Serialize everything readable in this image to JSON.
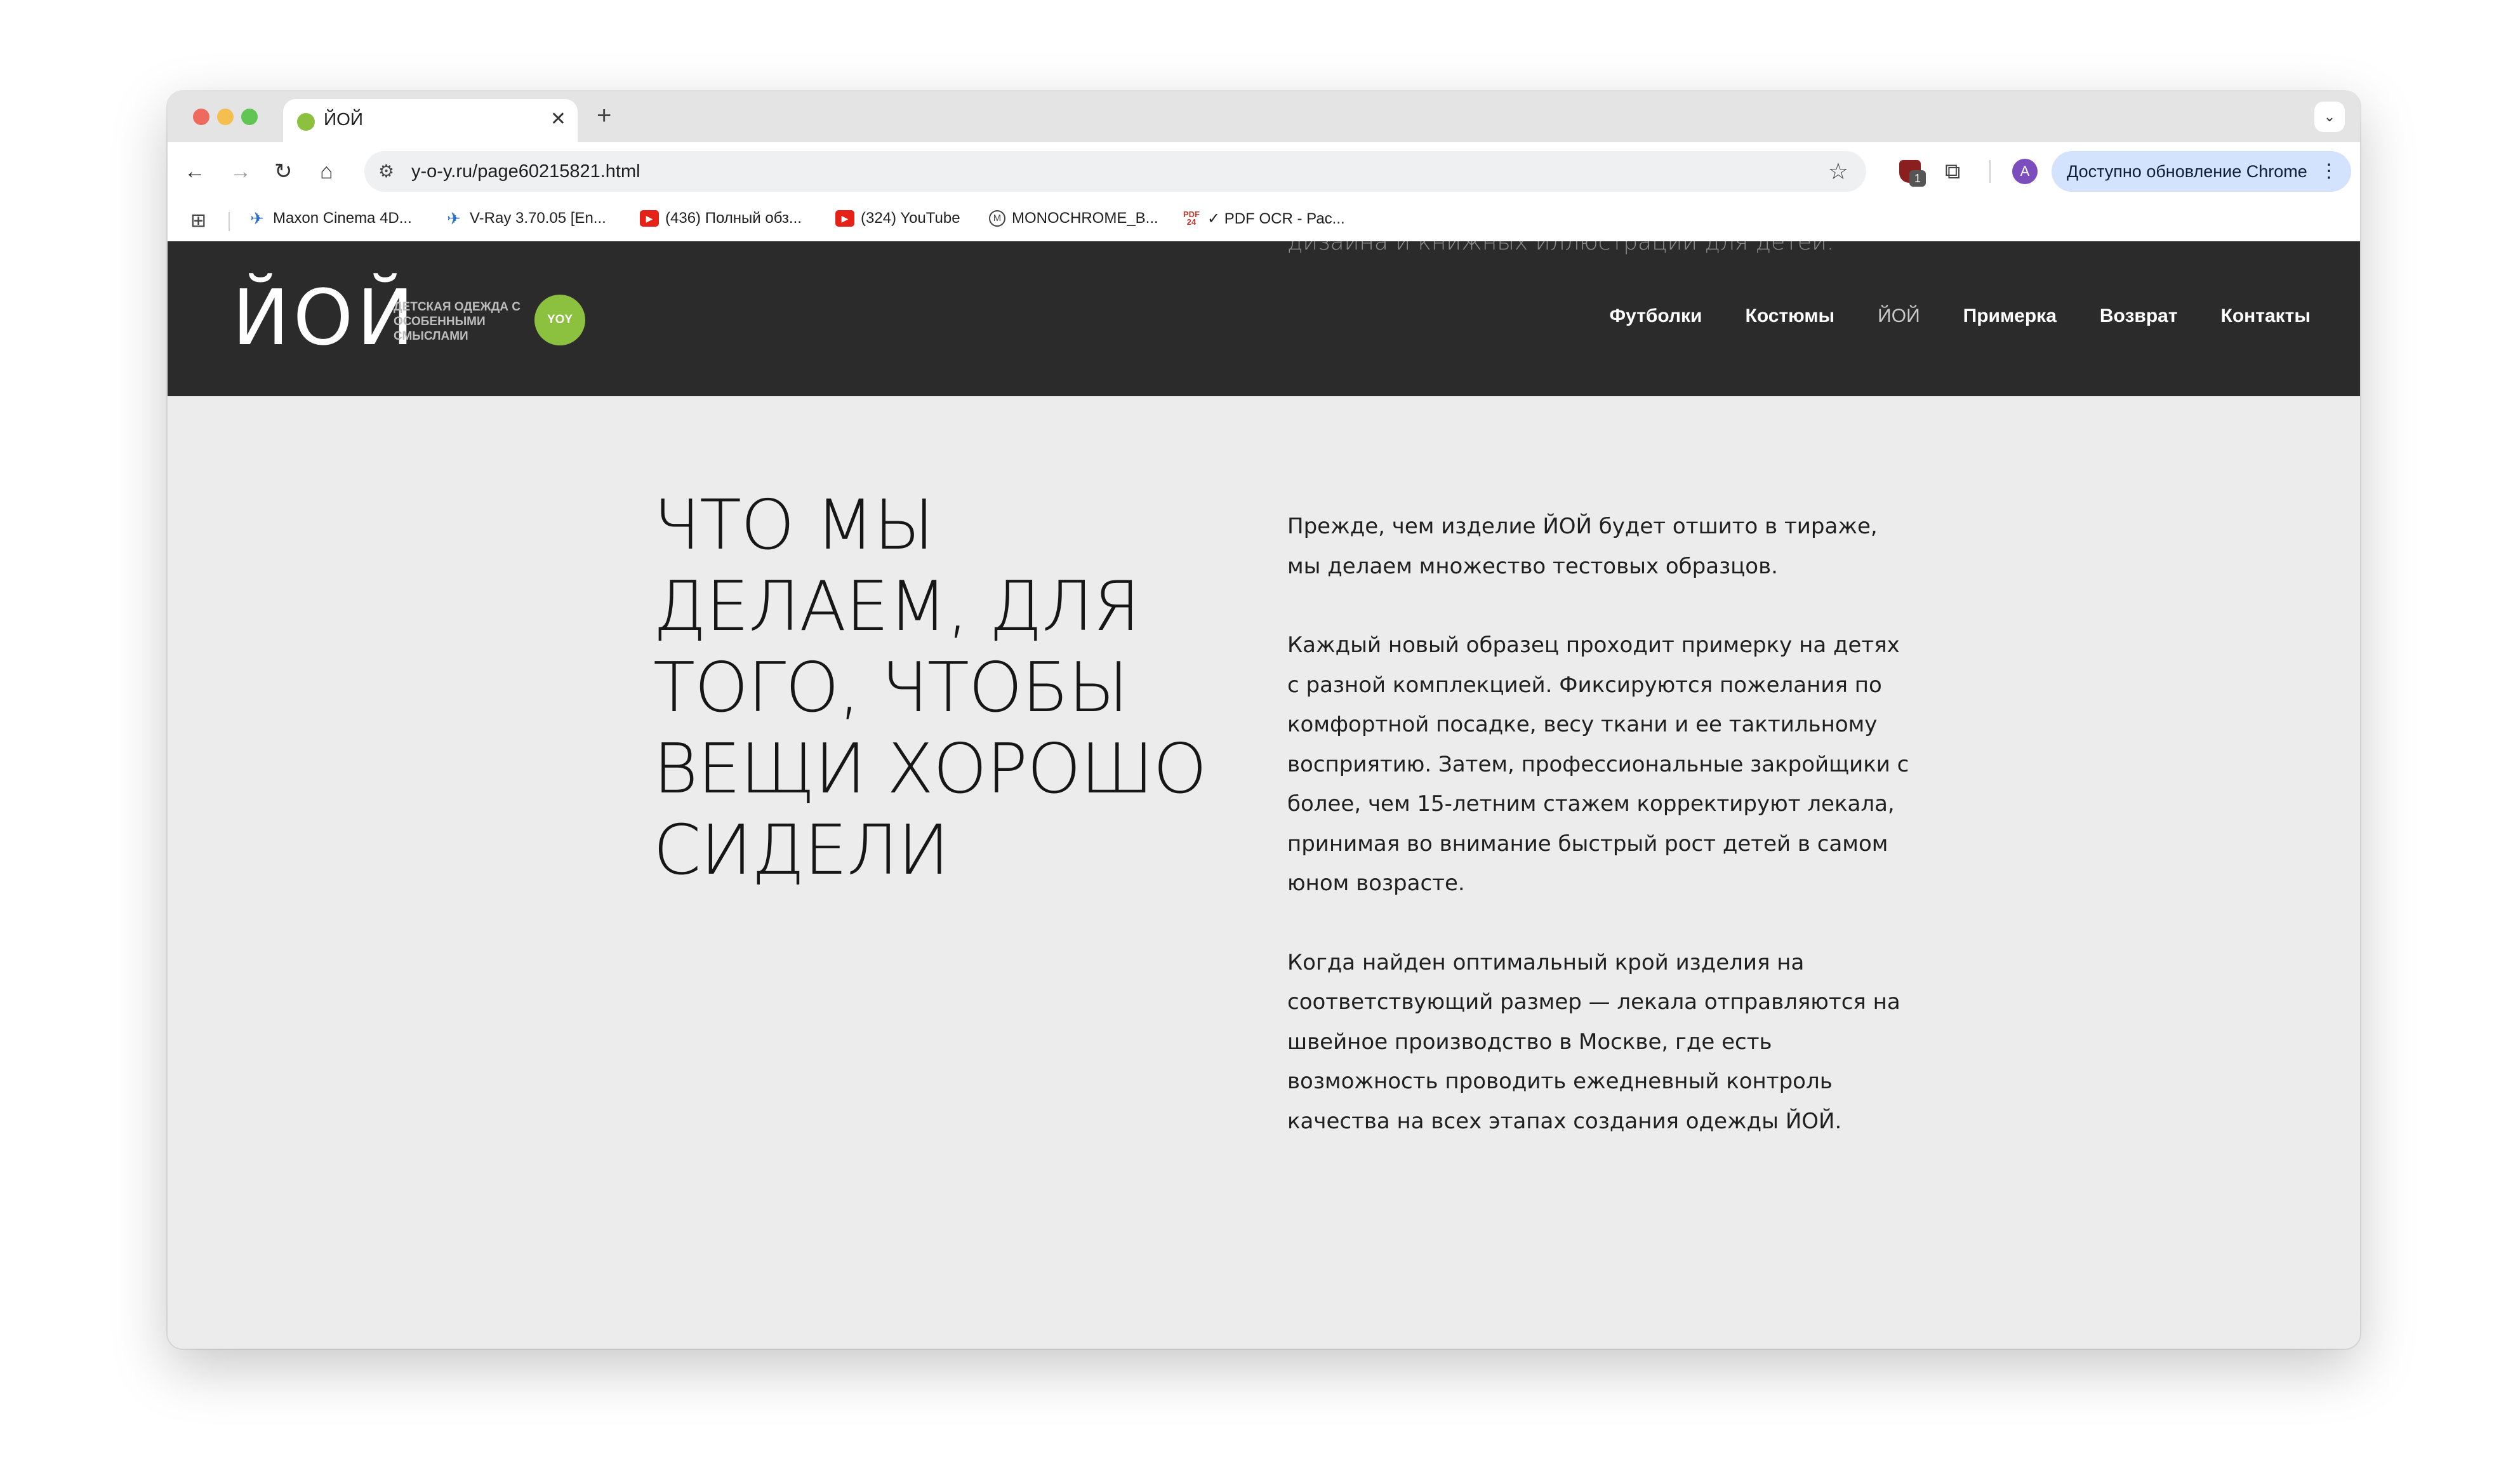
{
  "browser": {
    "tab": {
      "title": "ЙОЙ",
      "favicon": "yoy-favicon"
    },
    "new_tab_label": "+",
    "tab_search_icon": "chevron-down-icon",
    "url": "y-o-y.ru/page60215821.html",
    "extension_badge": "1",
    "profile_initial": "A",
    "update_label": "Доступно обновление Chrome",
    "bookmarks": [
      {
        "icon": "bird-icon",
        "label": "Maxon Cinema 4D..."
      },
      {
        "icon": "bird-icon",
        "label": "V-Ray 3.70.05 [En..."
      },
      {
        "icon": "youtube-icon",
        "label": "(436) Полный обз..."
      },
      {
        "icon": "youtube-icon",
        "label": "(324) YouTube"
      },
      {
        "icon": "monochrome-icon",
        "label": "MONOCHROME_B..."
      },
      {
        "icon": "pdf24-icon",
        "label": "✓ PDF OCR - Рас..."
      }
    ]
  },
  "site": {
    "peek_text": "дизайна и книжных иллюстраций для детей.",
    "logo": {
      "word": "ЙОЙ",
      "tagline": "ДЕТСКАЯ ОДЕЖДА С ОСОБЕННЫМИ СМЫСЛАМИ",
      "badge": "YOY"
    },
    "nav": [
      "Футболки",
      "Костюмы",
      "ЙОЙ",
      "Примерка",
      "Возврат",
      "Контакты"
    ],
    "heading": "ЧТО МЫ ДЕЛАЕМ, ДЛЯ ТОГО, ЧТОБЫ ВЕЩИ ХОРОШО СИДЕЛИ",
    "paragraphs": [
      "Прежде, чем изделие ЙОЙ будет отшито в тираже, мы делаем множество тестовых образцов.",
      "Каждый новый образец проходит примерку на детях с разной комплекцией. Фиксируются пожелания по комфортной посадке, весу ткани и ее тактильному восприятию. Затем, профессиональные закройщики с более, чем 15-летним стажем корректируют лекала, принимая во внимание быстрый рост детей в самом юном возрасте.",
      "Когда найден оптимальный крой изделия на соответствующий размер — лекала отправляются на швейное производство в Москве, где есть возможность проводить ежедневный контроль качества на всех этапах создания одежды ЙОЙ."
    ]
  },
  "colors": {
    "header_bg": "#2b2b2b",
    "page_bg": "#ececec",
    "brand_green": "#8cc13f",
    "update_pill": "#d3e3fd"
  }
}
